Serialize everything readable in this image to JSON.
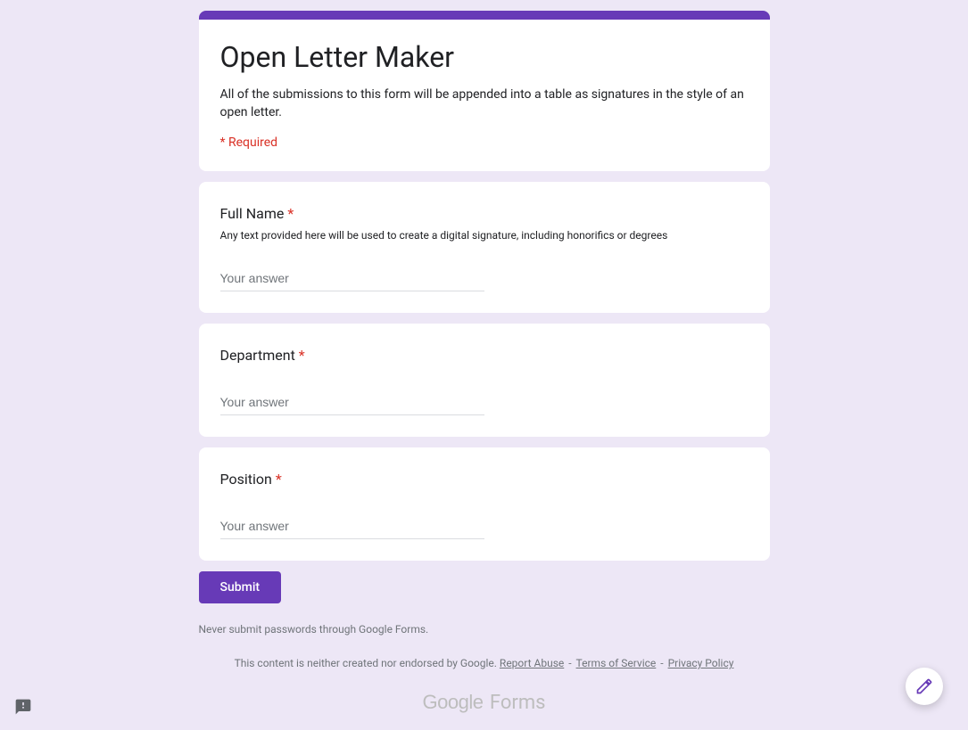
{
  "header": {
    "title": "Open Letter Maker",
    "description": "All of the submissions to this form will be appended into a table as signatures in the style of an open letter.",
    "required_notice": "* Required"
  },
  "questions": [
    {
      "label": "Full Name",
      "required": "*",
      "hint": "Any text provided here will be used to create a digital signature, including honorifics or degrees",
      "placeholder": "Your answer"
    },
    {
      "label": "Department",
      "required": "*",
      "hint": "",
      "placeholder": "Your answer"
    },
    {
      "label": "Position",
      "required": "*",
      "hint": "",
      "placeholder": "Your answer"
    }
  ],
  "submit": {
    "label": "Submit"
  },
  "footer": {
    "password_warning": "Never submit passwords through Google Forms.",
    "disclaimer_text": "This content is neither created nor endorsed by Google. ",
    "report_abuse": "Report Abuse",
    "terms": "Terms of Service",
    "privacy": "Privacy Policy",
    "logo_google": "Google",
    "logo_forms": " Forms"
  }
}
